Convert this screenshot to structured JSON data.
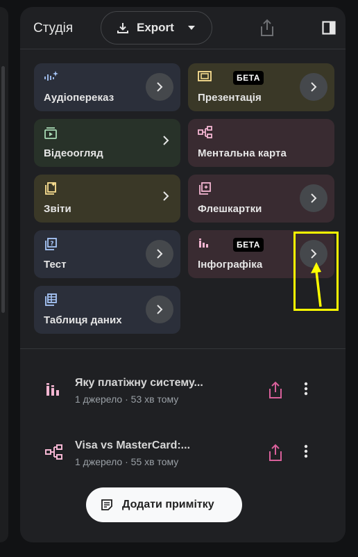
{
  "header": {
    "title": "Студія",
    "export_label": "Export"
  },
  "tiles": [
    {
      "label": "Аудіопереказ",
      "icon": "audio-sparkle-icon"
    },
    {
      "label": "Презентація",
      "icon": "slides-icon",
      "badge": "БЕТА"
    },
    {
      "label": "Відеоогляд",
      "icon": "video-icon"
    },
    {
      "label": "Ментальна карта",
      "icon": "mindmap-icon"
    },
    {
      "label": "Звіти",
      "icon": "reports-icon"
    },
    {
      "label": "Флешкартки",
      "icon": "flashcards-icon"
    },
    {
      "label": "Тест",
      "icon": "quiz-icon"
    },
    {
      "label": "Інфографіка",
      "icon": "infographic-icon",
      "badge": "БЕТА"
    },
    {
      "label": "Таблиця даних",
      "icon": "table-icon"
    }
  ],
  "notes": [
    {
      "title": "Яку платіжну систему...",
      "meta": "1 джерело · 53 хв тому",
      "icon": "infographic-icon"
    },
    {
      "title": "Visa vs MasterCard:...",
      "meta": "1 джерело · 55 хв тому",
      "icon": "mindmap-icon"
    }
  ],
  "add_note_label": "Додати примітку",
  "colors": {
    "accent_pink": "#d8609a",
    "highlight": "#ffff00"
  }
}
